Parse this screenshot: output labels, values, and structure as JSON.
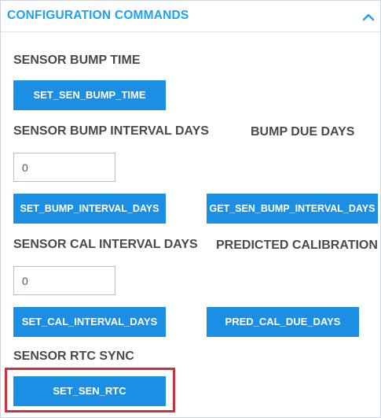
{
  "header": {
    "title": "CONFIGURATION COMMANDS",
    "collapse_icon": "chevron-up-icon"
  },
  "bump_time": {
    "label": "SENSOR BUMP TIME",
    "set_button": "SET_SEN_BUMP_TIME"
  },
  "bump_interval": {
    "label": "SENSOR BUMP INTERVAL DAYS",
    "due_label": "BUMP DUE DAYS",
    "input_value": "0",
    "set_button": "SET_BUMP_INTERVAL_DAYS",
    "get_button": "GET_SEN_BUMP_INTERVAL_DAYS"
  },
  "cal_interval": {
    "label": "SENSOR CAL INTERVAL DAYS",
    "predicted_label": "PREDICTED CALIBRATION",
    "input_value": "0",
    "set_button": "SET_CAL_INTERVAL_DAYS",
    "pred_button": "PRED_CAL_DUE_DAYS"
  },
  "rtc_sync": {
    "label": "SENSOR RTC SYNC",
    "set_button": "SET_SEN_RTC"
  },
  "colors": {
    "accent": "#1da1f2",
    "button": "#1a8fe3",
    "highlight": "#c8323a"
  }
}
